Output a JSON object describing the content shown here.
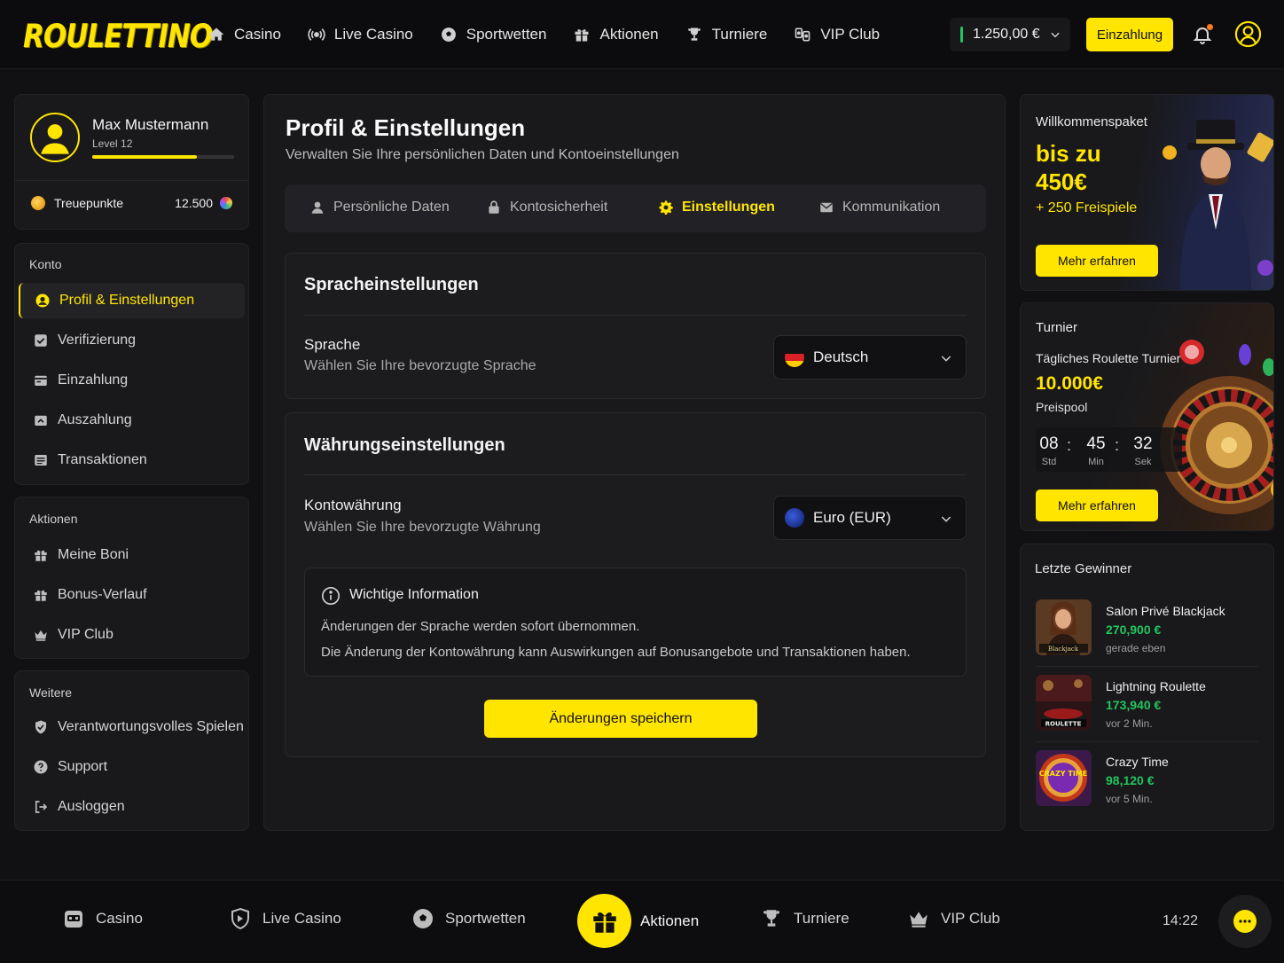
{
  "brand": {
    "logo_text": "ROULETTINO",
    "accent": "#ffe500",
    "success": "#22c55e"
  },
  "topnav": {
    "items": [
      {
        "label": "Casino",
        "icon": "home-icon"
      },
      {
        "label": "Live Casino",
        "icon": "live-broadcast-icon"
      },
      {
        "label": "Sportwetten",
        "icon": "football-icon"
      },
      {
        "label": "Aktionen",
        "icon": "gift-icon"
      },
      {
        "label": "Turniere",
        "icon": "trophy-icon"
      },
      {
        "label": "VIP Club",
        "icon": "cards-icon"
      }
    ],
    "balance": "1.250,00 €",
    "deposit_label": "Einzahlung"
  },
  "profile": {
    "name": "Max Mustermann",
    "level": "Level 12",
    "level_progress": 0.74,
    "loyalty_label": "Treuepunkte",
    "loyalty_value": "12.500"
  },
  "sidebar": {
    "konto": {
      "heading": "Konto",
      "items": [
        {
          "label": "Profil & Einstellungen",
          "icon": "user-circle-icon",
          "active": true
        },
        {
          "label": "Verifizierung",
          "icon": "check-square-icon"
        },
        {
          "label": "Einzahlung",
          "icon": "wallet-in-icon"
        },
        {
          "label": "Auszahlung",
          "icon": "wallet-out-icon"
        },
        {
          "label": "Transaktionen",
          "icon": "list-icon"
        }
      ]
    },
    "aktionen": {
      "heading": "Aktionen",
      "items": [
        {
          "label": "Meine Boni",
          "icon": "gift-icon"
        },
        {
          "label": "Bonus-Verlauf",
          "icon": "gift-history-icon"
        },
        {
          "label": "VIP Club",
          "icon": "crown-icon"
        }
      ]
    },
    "weitere": {
      "heading": "Weitere",
      "items": [
        {
          "label": "Verantwortungsvolles Spielen",
          "icon": "shield-check-icon"
        },
        {
          "label": "Support",
          "icon": "help-circle-icon"
        },
        {
          "label": "Ausloggen",
          "icon": "logout-icon"
        }
      ]
    }
  },
  "main": {
    "title": "Profil & Einstellungen",
    "subtitle": "Verwalten Sie Ihre persönlichen Daten und Kontoeinstellungen",
    "tabs": [
      {
        "label": "Persönliche Daten",
        "icon": "user-icon"
      },
      {
        "label": "Kontosicherheit",
        "icon": "lock-icon"
      },
      {
        "label": "Einstellungen",
        "icon": "gear-icon",
        "active": true
      },
      {
        "label": "Kommunikation",
        "icon": "mail-icon"
      }
    ],
    "language": {
      "title": "Spracheinstellungen",
      "label": "Sprache",
      "hint": "Wählen Sie Ihre bevorzugte Sprache",
      "value": "Deutsch"
    },
    "currency": {
      "title": "Währungseinstellungen",
      "label": "Kontowährung",
      "hint": "Wählen Sie Ihre bevorzugte Währung",
      "value": "Euro (EUR)"
    },
    "info": {
      "title": "Wichtige Information",
      "line1": "Änderungen der Sprache werden sofort übernommen.",
      "line2": "Die Änderung der Kontowährung kann Auswirkungen auf Bonusangebote und Transaktionen haben."
    },
    "save_label": "Änderungen speichern"
  },
  "promo": {
    "small": "Willkommenspaket",
    "big": "bis zu 450€",
    "spins": "+ 250 Freispiele",
    "button": "Mehr erfahren"
  },
  "tournament": {
    "label": "Turnier",
    "name": "Tägliches Roulette Turnier",
    "prize": "10.000€",
    "pool": "Preispool",
    "hours": "08",
    "hours_label": "Std",
    "minutes": "45",
    "minutes_label": "Min",
    "seconds": "32",
    "seconds_label": "Sek",
    "button": "Mehr erfahren"
  },
  "winners": {
    "heading": "Letzte Gewinner",
    "items": [
      {
        "game": "Salon Privé Blackjack",
        "amount": "270,900 €",
        "time": "gerade eben",
        "thumb_text": "Blackjack"
      },
      {
        "game": "Lightning Roulette",
        "amount": "173,940 €",
        "time": "vor 2 Min.",
        "thumb_text": "ROULETTE"
      },
      {
        "game": "Crazy Time",
        "amount": "98,120 €",
        "time": "vor 5 Min.",
        "thumb_text": "CRAZY TIME"
      }
    ]
  },
  "bottomnav": {
    "items": [
      {
        "label": "Casino",
        "icon": "slot-machine-icon"
      },
      {
        "label": "Live Casino",
        "icon": "shield-live-icon"
      },
      {
        "label": "Sportwetten",
        "icon": "football-icon"
      },
      {
        "label": "Aktionen",
        "icon": "gift-icon",
        "active": true
      },
      {
        "label": "Turniere",
        "icon": "trophy-icon"
      },
      {
        "label": "VIP Club",
        "icon": "crown-icon"
      }
    ],
    "clock": "14:22"
  }
}
